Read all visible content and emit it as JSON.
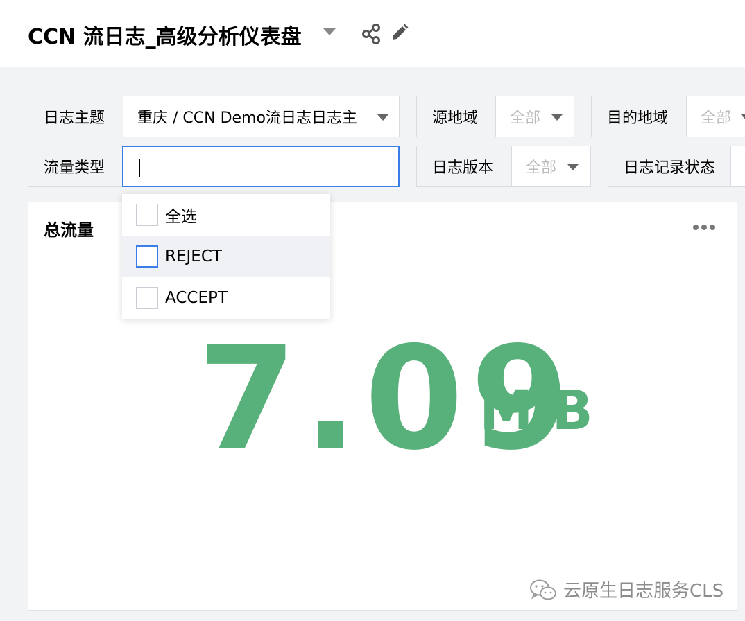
{
  "header": {
    "title": "CCN 流日志_高级分析仪表盘"
  },
  "filters": {
    "log_topic": {
      "label": "日志主题",
      "value": "重庆 / CCN Demo流日志日志主"
    },
    "source_region": {
      "label": "源地域",
      "value": "全部"
    },
    "dest_region": {
      "label": "目的地域",
      "value": "全部"
    },
    "traffic_type": {
      "label": "流量类型",
      "value": ""
    },
    "log_version": {
      "label": "日志版本",
      "value": "全部"
    },
    "log_status": {
      "label": "日志记录状态"
    }
  },
  "dropdown": {
    "options": [
      {
        "label": "全选",
        "checked": false
      },
      {
        "label": "REJECT",
        "checked": false,
        "highlighted": true
      },
      {
        "label": "ACCEPT",
        "checked": false
      }
    ]
  },
  "panel": {
    "title": "总流量",
    "value": "7.09",
    "unit": "MiB",
    "value_color": "#58b07a"
  },
  "watermark": {
    "text": "云原生日志服务CLS"
  },
  "colors": {
    "accent": "#3b7de9",
    "metric": "#58b07a"
  }
}
